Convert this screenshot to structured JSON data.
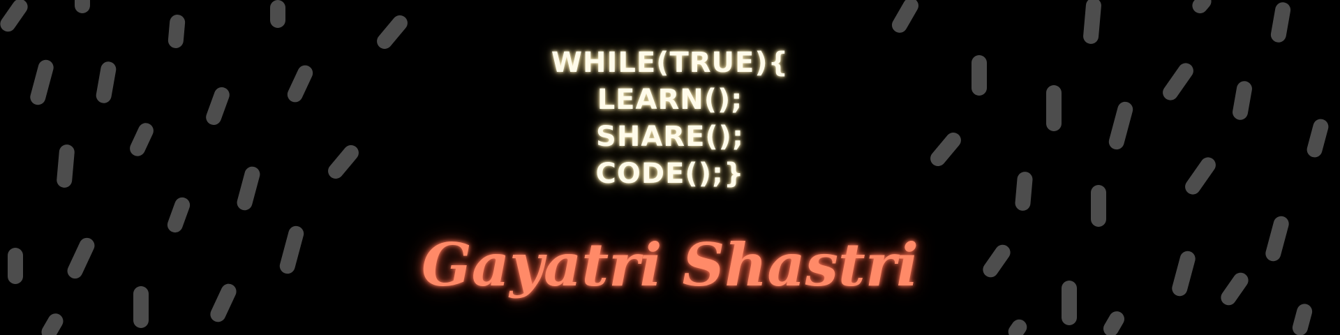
{
  "code_lines": [
    "WHILE(TRUE){",
    "LEARN();",
    "SHARE();",
    "CODE();}"
  ],
  "name": "Gayatri Shastri",
  "colors": {
    "background": "#000000",
    "code_text": "#fffbea",
    "name_text": "#ff8a68",
    "dash": "#4d4d4d"
  }
}
